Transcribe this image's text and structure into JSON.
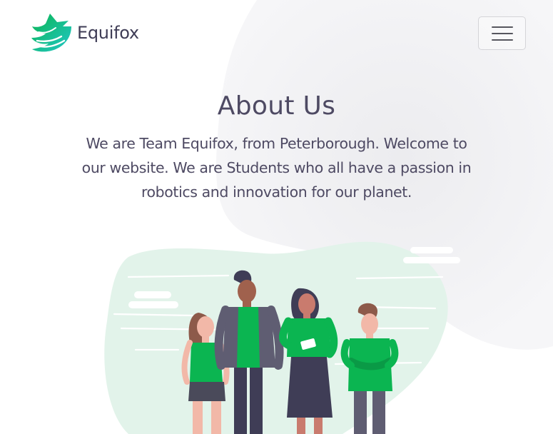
{
  "navbar": {
    "brand_name": "Equifox",
    "logo_icon": "fox-logo-icon",
    "menu_icon": "hamburger-menu-icon",
    "menu_label": "Toggle navigation"
  },
  "hero": {
    "title": "About Us",
    "text": "We are Team Equifox, from Peterborough. Welcome to our website. We are Students who all have a passion in robotics and innovation for our planet."
  },
  "illustration": {
    "name": "team-illustration"
  },
  "colors": {
    "accent_green": "#0bb551",
    "logo_teal": "#1fc8a8",
    "text_dark": "#4e4a63",
    "blob_gray": "#f2f2f4",
    "blob_mint": "#e4f3ec"
  }
}
